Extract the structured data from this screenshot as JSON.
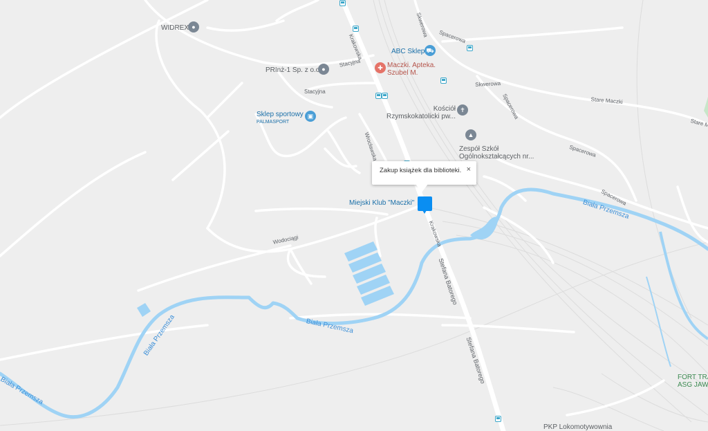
{
  "info_window": {
    "text": "Zakup książek dla biblioteki.",
    "close_label": "×"
  },
  "streets": {
    "krakowska_1": "Krakowska",
    "krakowska_2": "Krakowska",
    "stacyjna_1": "Stacyjna",
    "stacyjna_2": "Stacyjna",
    "skwerowa_1": "Skwerowa",
    "skwerowa_2": "Skwerowa",
    "spacerowa_1": "Spacerowa",
    "spacerowa_2": "Spacerowa",
    "spacerowa_3": "Spacerowa",
    "spacerowa_4": "Spacerowa",
    "stare_maczki_1": "Stare Maczki",
    "stare_maczki_2": "Stare Maczki",
    "wodociagi": "Wodociągi",
    "wroclawska": "Wrocławska Ka",
    "batorego_1": "Stefana Batorego",
    "batorego_2": "Stefana Batorego"
  },
  "rivers": {
    "r1": "Biała Przemsza",
    "r2": "Biała Przemsza",
    "r3": "Biała Przemsza",
    "r4": "Biała Przemsza"
  },
  "places": {
    "widrex": "WIDREX",
    "prinz": "PRInż-1 Sp. z o.o",
    "abc": "ABC Sklep",
    "apteka_line1": "Maczki. Apteka.",
    "apteka_line2": "Szubel M.",
    "kosciol_line1": "Kościół",
    "kosciol_line2": "Rzymskokatolicki pw...",
    "sklep_line1": "Sklep sportowy",
    "sklep_line2": "PALMASPORT",
    "zespol_line1": "Zespół Szkół",
    "zespol_line2": "Ogólnokształcących nr...",
    "klub": "Miejski Klub \"Maczki\"",
    "fort_line1": "FORT TRA",
    "fort_line2": "ASG JAWORZN",
    "pkp": "PKP Lokomotywownia"
  },
  "icons": {
    "poi_grey": "map-pin-icon",
    "shop": "cart-icon",
    "pharmacy": "pharmacy-icon",
    "church": "church-icon",
    "school": "school-icon",
    "store": "shopping-bag-icon",
    "bus": "bus-stop-icon",
    "marker": "selected-marker-icon"
  },
  "colors": {
    "background": "#eeeeee",
    "road": "#ffffff",
    "water": "#9fd3f5",
    "marker": "#0a8ef2",
    "poi_grey": "#7b8794",
    "poi_blue": "#4a9ed6",
    "poi_red": "#e57368"
  }
}
